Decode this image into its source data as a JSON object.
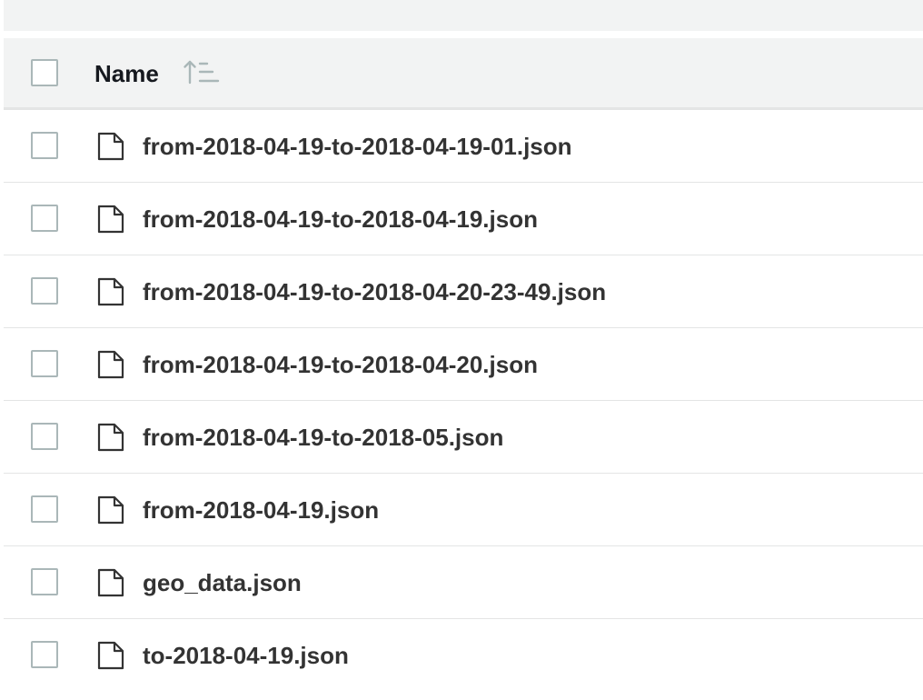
{
  "table": {
    "header": {
      "name_label": "Name",
      "sort_icon": "sort-ascending-icon"
    },
    "rows": [
      {
        "name": "from-2018-04-19-to-2018-04-19-01.json",
        "icon": "file-icon"
      },
      {
        "name": "from-2018-04-19-to-2018-04-19.json",
        "icon": "file-icon"
      },
      {
        "name": "from-2018-04-19-to-2018-04-20-23-49.json",
        "icon": "file-icon"
      },
      {
        "name": "from-2018-04-19-to-2018-04-20.json",
        "icon": "file-icon"
      },
      {
        "name": "from-2018-04-19-to-2018-05.json",
        "icon": "file-icon"
      },
      {
        "name": "from-2018-04-19.json",
        "icon": "file-icon"
      },
      {
        "name": "geo_data.json",
        "icon": "file-icon"
      },
      {
        "name": "to-2018-04-19.json",
        "icon": "file-icon"
      }
    ]
  },
  "colors": {
    "header_background": "#f2f3f3",
    "divider": "#e4e5e5",
    "checkbox_border": "#aab7b8",
    "text": "#333333"
  }
}
